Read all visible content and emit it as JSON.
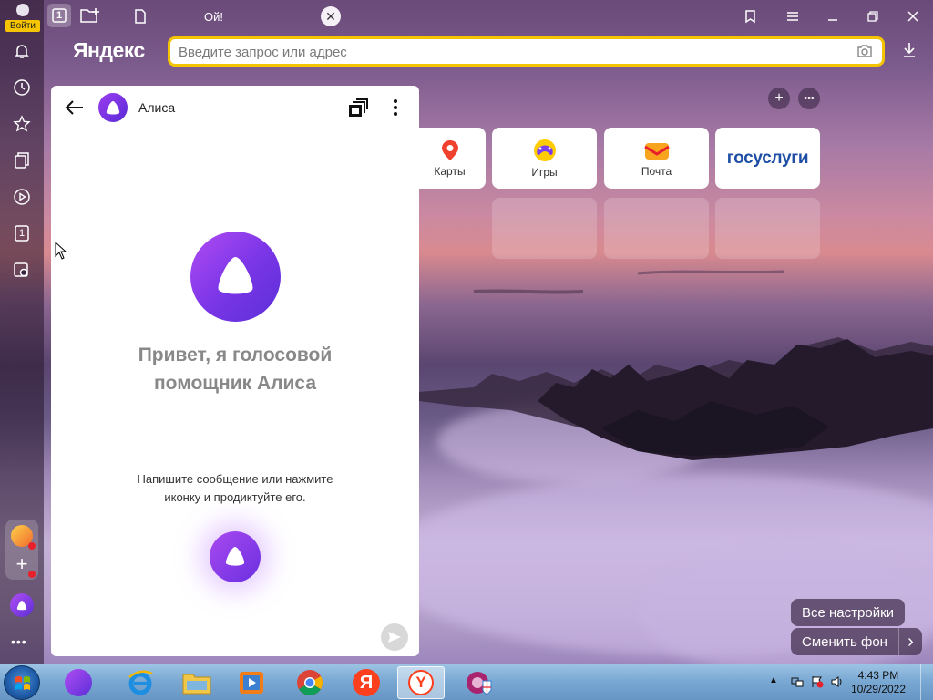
{
  "browser": {
    "logo": "Яндекс",
    "tab_title": "Ой!",
    "tab_counter": "1",
    "search_placeholder": "Введите запрос или адрес",
    "accent": "#f5c400"
  },
  "sidebar": {
    "login_label": "Войти",
    "counter_label": "1",
    "icons": [
      "bell-icon",
      "history-icon",
      "star-icon",
      "collections-icon",
      "play-icon",
      "tabs-counter-icon",
      "screenshot-icon"
    ]
  },
  "tiles": [
    {
      "label": "Карты",
      "icon": "maps-pin-icon"
    },
    {
      "label": "Игры",
      "icon": "games-gamepad-icon"
    },
    {
      "label": "Почта",
      "icon": "mail-envelope-icon"
    },
    {
      "label": "госуслуги",
      "icon": "gosuslugi-logo"
    }
  ],
  "actions": {
    "all_settings": "Все настройки",
    "change_background": "Сменить фон",
    "chevron": "›"
  },
  "alice": {
    "title": "Алиса",
    "greeting_line1": "Привет, я голосовой",
    "greeting_line2": "помощник Алиса",
    "hint_line1": "Напишите сообщение или нажмите",
    "hint_line2": "иконку и продиктуйте его.",
    "accent": "#7c36e8"
  },
  "taskbar": {
    "time": "4:43 PM",
    "date": "10/29/2022",
    "apps": [
      "alice-icon",
      "internet-explorer-icon",
      "file-explorer-icon",
      "media-player-icon",
      "chrome-icon",
      "yandex-red-icon",
      "yandex-browser-icon",
      "ie-shield-icon"
    ]
  }
}
